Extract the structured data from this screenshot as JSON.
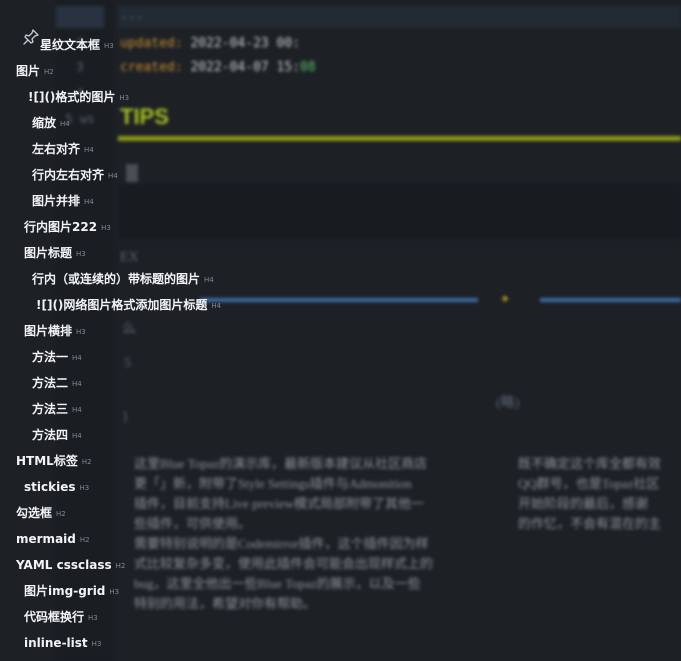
{
  "editor": {
    "line_numbers": [
      "1",
      "2",
      "3",
      "4",
      "5"
    ],
    "line5_suffix": "ws",
    "frontmatter_open": "---",
    "updated_key": "updated:",
    "updated_val": "2022-04-23 00:",
    "created_key": "created:",
    "created_val": "2022-04-07 15:",
    "created_val_tail": "08",
    "tips_heading": "TIPS",
    "faint_marks": [
      "ЕХ",
      "5",
      "}",
      "么",
      "(略)"
    ],
    "para_left": [
      "这里Blue Topaz的演示库，最新版本建议从社区商店",
      "更「」新，附带了Style Settings插件与Admonition",
      "插件，目前支持Live preview模式局部附带了其他一",
      "些插件，可供使用。",
      "需要特别说明的是Codemirror插件，这个插件因为样",
      "式比较复杂多变，使用此插件会可能会出现样式上的",
      "bug，这里全他出一些Blue Topaz的展示，以及一些",
      "特别的用法，希望对你有帮助。"
    ],
    "para_right": [
      "既不确定这个库全都有效",
      "QQ群号，也是Topaz社区",
      "开始阶段的最后，感谢",
      "的作忆，不会有混在的主"
    ]
  },
  "outline": {
    "items": [
      {
        "label": "星纹文本框",
        "level": "H3"
      },
      {
        "label": "图片",
        "level": "H2"
      },
      {
        "label": "![]()格式的图片",
        "level": "H3"
      },
      {
        "label": "缩放",
        "level": "H4"
      },
      {
        "label": "左右对齐",
        "level": "H4"
      },
      {
        "label": "行内左右对齐",
        "level": "H4"
      },
      {
        "label": "图片并排",
        "level": "H4"
      },
      {
        "label": "行内图片222",
        "level": "H3"
      },
      {
        "label": "图片标题",
        "level": "H3"
      },
      {
        "label": "行内（或连续的）带标题的图片",
        "level": "H4"
      },
      {
        "label": "![]()网络图片格式添加图片标题",
        "level": "H4"
      },
      {
        "label": "图片横排",
        "level": "H3"
      },
      {
        "label": "方法一",
        "level": "H4"
      },
      {
        "label": "方法二",
        "level": "H4"
      },
      {
        "label": "方法三",
        "level": "H4"
      },
      {
        "label": "方法四",
        "level": "H4"
      },
      {
        "label": "HTML标签",
        "level": "H2"
      },
      {
        "label": "stickies",
        "level": "H3"
      },
      {
        "label": "勾选框",
        "level": "H2"
      },
      {
        "label": "mermaid",
        "level": "H2"
      },
      {
        "label": "YAML cssclass",
        "level": "H2"
      },
      {
        "label": "图片img-grid",
        "level": "H3"
      },
      {
        "label": "代码框换行",
        "level": "H3"
      },
      {
        "label": "inline-list",
        "level": "H3"
      }
    ]
  },
  "colors": {
    "background": "#1d2126",
    "outline_text": "#f2f4f6",
    "yaml_key": "#c88b2f",
    "tips_heading": "#a7c21f",
    "rule_blue": "#3b6ea5"
  },
  "icons": {
    "pin": "pin-icon",
    "rule_ornament": "sparkle-icon"
  }
}
